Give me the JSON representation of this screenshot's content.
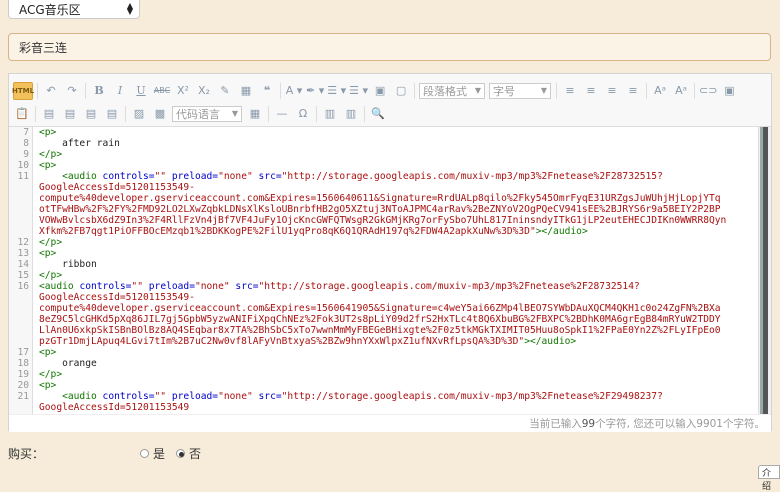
{
  "category": {
    "selected": "ACG音乐区"
  },
  "title_field": {
    "value": "彩音三连"
  },
  "toolbar": {
    "html_label": "HTML",
    "combos": {
      "paragraph": "段落格式",
      "font": "字号",
      "code_lang": "代码语言"
    }
  },
  "code_lines": [
    {
      "num": "7",
      "html": "<span class='tag'>&lt;p&gt;</span>"
    },
    {
      "num": "8",
      "html": "    <span class='txt'>after rain</span>"
    },
    {
      "num": "9",
      "html": "<span class='tag'>&lt;/p&gt;</span>"
    },
    {
      "num": "10",
      "html": "<span class='tag'>&lt;p&gt;</span>"
    },
    {
      "num": "11",
      "html": "    <span class='tag'>&lt;audio</span> <span class='attr'>controls=</span><span class='str'>\"\"</span> <span class='attr'>preload=</span><span class='str'>\"none\"</span> <span class='attr'>src=</span><span class='str'>\"http://storage.googleapis.com/muxiv-mp3/mp3%2Fnetease%2F28732515?</span>"
    },
    {
      "num": "",
      "html": "<span class='str'>GoogleAccessId=51201153549-</span>"
    },
    {
      "num": "",
      "html": "<span class='str'>compute%40developer.gserviceaccount.com&amp;Expires=1560640611&amp;Signature=RrdUALp8qilo%2Fky545OmrFyqE31URZgsJuWUhjHjLopjYTq</span>"
    },
    {
      "num": "",
      "html": "<span class='str'>otTFwHBw%2F%2FY%2FMD92LO2LXwZqbkLDNsXlKsloUBnrbfHB2gO5XZtuj3NToAJPMC4arRav%2BeZNYoV2OgPQeCV941sEE%2BJRYS6r9a5BEIY2P2BP</span>"
    },
    {
      "num": "",
      "html": "<span class='str'>VOWwBvlcsbX6dZ9In3%2F4RllFzVn4jBf7VF4JuFy1OjcKncGWFQTWsgR2GkGMjKRg7orFySbo7UhL817IninsndyITkG1jLP2eutEHECJDIKn0WWRR8Qyn</span>"
    },
    {
      "num": "",
      "html": "<span class='str'>Xfkm%2FB7qgt1PiOFFBOcEMzqb1%2BDKKogPE%2FilU1yqPro8qK6Q1QRAdH197q%2FDW4A2apkXuNw%3D%3D\"</span><span class='tag'>&gt;&lt;/audio&gt;</span>"
    },
    {
      "num": "12",
      "html": "<span class='tag'>&lt;/p&gt;</span>"
    },
    {
      "num": "13",
      "html": "<span class='tag'>&lt;p&gt;</span>"
    },
    {
      "num": "14",
      "html": "    <span class='txt'>ribbon</span>"
    },
    {
      "num": "15",
      "html": "<span class='tag'>&lt;/p&gt;</span>"
    },
    {
      "num": "16",
      "html": "<span class='tag'>&lt;audio</span> <span class='attr'>controls=</span><span class='str'>\"\"</span> <span class='attr'>preload=</span><span class='str'>\"none\"</span> <span class='attr'>src=</span><span class='str'>\"http://storage.googleapis.com/muxiv-mp3/mp3%2Fnetease%2F28732514?</span>"
    },
    {
      "num": "",
      "html": "<span class='str'>GoogleAccessId=51201153549-</span>"
    },
    {
      "num": "",
      "html": "<span class='str'>compute%40developer.gserviceaccount.com&amp;Expires=1560641905&amp;Signature=c4weY5ai66ZMp4lBEO7SYWbDAuXQCM4QKH1c0o24ZgFN%2BXa</span>"
    },
    {
      "num": "",
      "html": "<span class='str'>8eZ9C5lcGHKd5pXq86JIL7gj5GpbW5yzwANIFiXpqChNEz%2Fok3UT2s8pLiY09d2frS2HxTLc4t8Q6XbuBG%2FBXPC%2BDhK0MA6grEgB84mRYuW2TDDY</span>"
    },
    {
      "num": "",
      "html": "<span class='str'>LlAn0U6xkpSkISBnBOlBz8AQ4SEqbar8x7TA%2BhSbC5xTo7wwnMmMyFBEGeBHixgte%2F0z5tkMGkTXIMIT05Huu8oSpkI1%2FPaE0Yn2Z%2FLyIFpEo0</span>"
    },
    {
      "num": "",
      "html": "<span class='str'>pzGTr1DmjLApuq4LGvi7tIm%2B7uC2Nw0vf8lAFyVnBtxyaS%2BZw9hnYXxWlpxZ1ufNXvRfLpsQA%3D%3D\"</span><span class='tag'>&gt;&lt;/audio&gt;</span>"
    },
    {
      "num": "17",
      "html": "<span class='tag'>&lt;p&gt;</span>"
    },
    {
      "num": "18",
      "html": "    <span class='txt'>orange</span>"
    },
    {
      "num": "19",
      "html": "<span class='tag'>&lt;/p&gt;</span>"
    },
    {
      "num": "20",
      "html": "<span class='tag'>&lt;p&gt;</span>"
    },
    {
      "num": "21",
      "html": "    <span class='tag'>&lt;audio</span> <span class='attr'>controls=</span><span class='str'>\"\"</span> <span class='attr'>preload=</span><span class='str'>\"none\"</span> <span class='attr'>src=</span><span class='str'>\"http://storage.googleapis.com/muxiv-mp3/mp3%2Fnetease%2F29498237?</span>"
    },
    {
      "num": "",
      "html": "<span class='str'>GoogleAccessId=51201153549</span>"
    }
  ],
  "status": {
    "prefix": "当前已输入",
    "count": "99",
    "suffix": "个字符, 您还可以输入9901个字符。"
  },
  "purchase": {
    "label": "购买：",
    "yes": "是",
    "no": "否",
    "selected": "no"
  },
  "corner": {
    "label": "介绍"
  }
}
